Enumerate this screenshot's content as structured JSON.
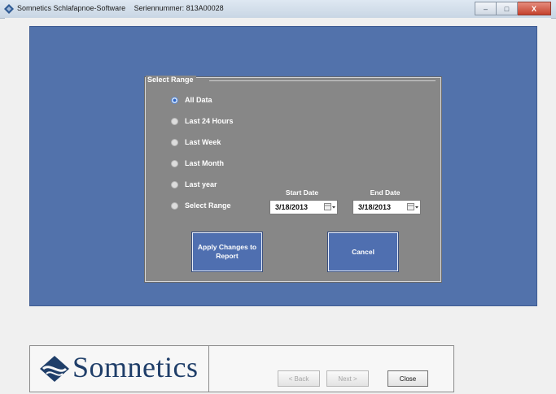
{
  "window": {
    "title": "Somnetics Schlafapnoe-Software",
    "serial_label": "Seriennummer: 813A00028",
    "minimize": "–",
    "maximize": "□",
    "close": "X"
  },
  "range_dialog": {
    "legend": "Select Range",
    "options": [
      {
        "label": "All Data",
        "checked": true
      },
      {
        "label": "Last 24 Hours",
        "checked": false
      },
      {
        "label": "Last Week",
        "checked": false
      },
      {
        "label": "Last Month",
        "checked": false
      },
      {
        "label": "Last year",
        "checked": false
      },
      {
        "label": "Select Range",
        "checked": false
      }
    ],
    "start_date_label": "Start Date",
    "end_date_label": "End Date",
    "start_date": "3/18/2013",
    "end_date": "3/18/2013",
    "apply_button": "Apply Changes to Report",
    "cancel_button": "Cancel"
  },
  "footer": {
    "logo_text": "Somnetics",
    "back_button": "< Back",
    "next_button": "Next >",
    "close_button": "Close"
  },
  "colors": {
    "report_panel": "#5272ab",
    "dialog_background": "#878787",
    "button_blue": "#4f6fb0",
    "logo_blue": "#1f3e69"
  },
  "icons": {
    "app": "somnetics-diamond-icon",
    "calendar": "calendar-dropdown-icon"
  }
}
